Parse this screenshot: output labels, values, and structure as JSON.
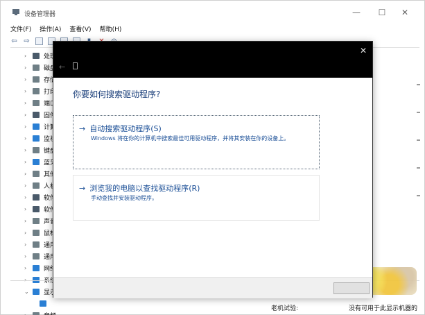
{
  "window": {
    "title": "设备管理器",
    "controls": {
      "minimize": "—",
      "maximize": "☐",
      "close": "✕"
    }
  },
  "menubar": [
    "文件(F)",
    "操作(A)",
    "查看(V)",
    "帮助(H)"
  ],
  "tree": {
    "items": [
      {
        "label": "处理",
        "icon": "cpu-icon"
      },
      {
        "label": "磁盘",
        "icon": "disk-icon"
      },
      {
        "label": "存储",
        "icon": "storage-icon"
      },
      {
        "label": "打印",
        "icon": "printer-icon"
      },
      {
        "label": "端口",
        "icon": "port-icon"
      },
      {
        "label": "固件",
        "icon": "firmware-icon"
      },
      {
        "label": "计算",
        "icon": "computer-icon"
      },
      {
        "label": "监视",
        "icon": "monitor-icon"
      },
      {
        "label": "键盘",
        "icon": "keyboard-icon"
      },
      {
        "label": "蓝牙",
        "icon": "bluetooth-icon"
      },
      {
        "label": "其他",
        "icon": "unknown-device-icon"
      },
      {
        "label": "人机",
        "icon": "hid-icon"
      },
      {
        "label": "软件",
        "icon": "software-icon"
      },
      {
        "label": "软件",
        "icon": "software-icon"
      },
      {
        "label": "声音",
        "icon": "sound-icon"
      },
      {
        "label": "鼠标",
        "icon": "mouse-icon"
      },
      {
        "label": "通用",
        "icon": "usb-icon"
      },
      {
        "label": "通用",
        "icon": "usb-icon"
      },
      {
        "label": "网络",
        "icon": "network-icon"
      },
      {
        "label": "系统",
        "icon": "system-icon"
      },
      {
        "label": "显示",
        "icon": "display-icon"
      }
    ],
    "last_item": {
      "label": "音频",
      "icon": "audio-icon"
    }
  },
  "statusbar": {
    "left": "老机试验:",
    "right": "没有可用于此显示机器的"
  },
  "dialog": {
    "heading": "你要如何搜索驱动程序?",
    "option1": {
      "title": "自动搜索驱动程序(S)",
      "description": "Windows 将在你的计算机中搜索最佳可用驱动程序，并将其安装在你的设备上。"
    },
    "option2": {
      "title": "浏览我的电脑以查找驱动程序(R)",
      "description": "手动查找并安装驱动程序。"
    },
    "close_glyph": "✕",
    "back_glyph": "←",
    "arrow_glyph": "→"
  }
}
